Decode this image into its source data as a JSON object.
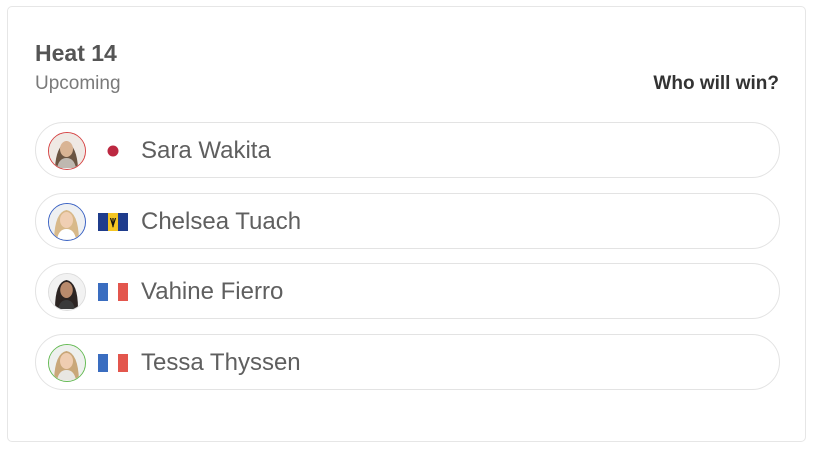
{
  "heat": {
    "title": "Heat 14",
    "status": "Upcoming",
    "prediction_label": "Who will win?"
  },
  "colors": {
    "jersey_red": "#d64545",
    "jersey_blue": "#3b63c4",
    "jersey_white": "#dddddd",
    "jersey_green": "#66bb55"
  },
  "athletes": [
    {
      "name": "Sara Wakita",
      "country_flag": "japan-flag-icon",
      "jersey": "red"
    },
    {
      "name": "Chelsea Tuach",
      "country_flag": "barbados-flag-icon",
      "jersey": "blue"
    },
    {
      "name": "Vahine Fierro",
      "country_flag": "france-flag-icon",
      "jersey": "white"
    },
    {
      "name": "Tessa Thyssen",
      "country_flag": "france-flag-icon",
      "jersey": "green"
    }
  ]
}
